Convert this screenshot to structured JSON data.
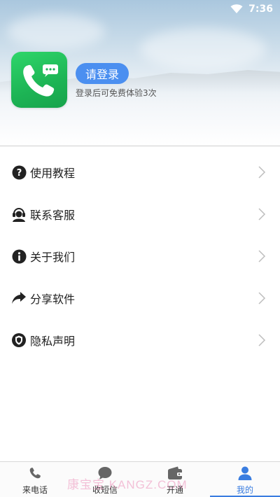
{
  "status_bar": {
    "time": "7:36"
  },
  "profile": {
    "login_label": "请登录",
    "login_hint": "登录后可免费体验3次"
  },
  "menu": {
    "items": [
      {
        "label": "使用教程",
        "icon": "question-circle-icon"
      },
      {
        "label": "联系客服",
        "icon": "customer-service-icon"
      },
      {
        "label": "关于我们",
        "icon": "info-circle-icon"
      },
      {
        "label": "分享软件",
        "icon": "share-arrow-icon"
      },
      {
        "label": "隐私声明",
        "icon": "shield-icon"
      }
    ]
  },
  "tabbar": {
    "tabs": [
      {
        "label": "来电话",
        "icon": "phone-icon"
      },
      {
        "label": "收短信",
        "icon": "chat-bubble-icon"
      },
      {
        "label": "开通",
        "icon": "wallet-icon"
      },
      {
        "label": "我的",
        "icon": "person-icon",
        "active": true
      }
    ]
  },
  "watermark": "康宝宝 KANGZ.COM",
  "colors": {
    "accent": "#3a7de0",
    "login_button": "#4b8ff0",
    "logo_green": "#1db455"
  }
}
